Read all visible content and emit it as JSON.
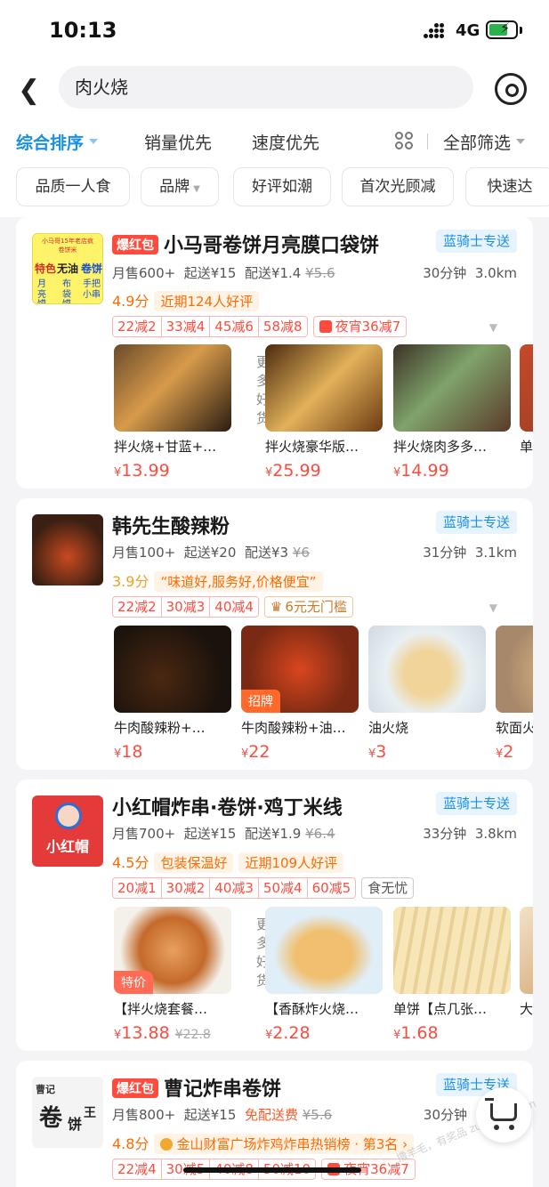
{
  "status": {
    "time": "10:13",
    "network": "4G"
  },
  "search": {
    "query": "肉火烧"
  },
  "sort": {
    "active": "综合排序",
    "sales": "销量优先",
    "speed": "速度优先",
    "filter": "全部筛选"
  },
  "chips": [
    "品质一人食",
    "品牌",
    "好评如潮",
    "首次光顾减",
    "快速达"
  ],
  "shops": [
    {
      "hot": "爆红包",
      "name": "小马哥卷饼月亮膜口袋饼",
      "delivery_tag": "蓝骑士专送",
      "monthly": "月售600+",
      "min": "起送¥15",
      "fee": "配送¥1.4",
      "fee_old": "¥5.6",
      "time": "30分钟",
      "dist": "3.0km",
      "score": "4.9分",
      "pills": [
        "近期124人好评"
      ],
      "coupons": [
        "22减2",
        "33减4",
        "45减6",
        "58减8"
      ],
      "extra": "夜宵36减7",
      "logo_text": [
        "小马哥15年老店疯",
        "卷饼米",
        "特色",
        "无油",
        "卷饼",
        "月",
        "布",
        "手把",
        "亮",
        "袋",
        "小串",
        "馍",
        "馍"
      ],
      "more": "更多好货",
      "dishes": [
        {
          "name": "拌火烧+甘蓝+…",
          "price": "13.99",
          "old": "",
          "badge": ""
        },
        {
          "name": "拌火烧豪华版…",
          "price": "25.99",
          "old": "",
          "badge": ""
        },
        {
          "name": "拌火烧肉多多…",
          "price": "14.99",
          "old": "",
          "badge": ""
        },
        {
          "name": "单",
          "price": "",
          "old": "",
          "badge": ""
        }
      ]
    },
    {
      "hot": "",
      "name": "韩先生酸辣粉",
      "delivery_tag": "蓝骑士专送",
      "monthly": "月售100+",
      "min": "起送¥20",
      "fee": "配送¥3",
      "fee_old": "¥6",
      "time": "31分钟",
      "dist": "3.1km",
      "score": "3.9分",
      "pills": [
        "“味道好,服务好,价格便宜”"
      ],
      "coupons": [
        "22减2",
        "30减3",
        "40减4"
      ],
      "extra": "6元无门槛",
      "dishes": [
        {
          "name": "牛肉酸辣粉+…",
          "price": "18",
          "old": "",
          "badge": ""
        },
        {
          "name": "牛肉酸辣粉+油…",
          "price": "22",
          "old": "",
          "badge": "招牌"
        },
        {
          "name": "油火烧",
          "price": "3",
          "old": "",
          "badge": ""
        },
        {
          "name": "软面火",
          "price": "2",
          "old": "",
          "badge": ""
        }
      ]
    },
    {
      "hot": "",
      "name": "小红帽炸串·卷饼·鸡丁米线",
      "delivery_tag": "蓝骑士专送",
      "monthly": "月售700+",
      "min": "起送¥15",
      "fee": "配送¥1.9",
      "fee_old": "¥6.4",
      "time": "33分钟",
      "dist": "3.8km",
      "score": "4.5分",
      "pills": [
        "包装保温好",
        "近期109人好评"
      ],
      "coupons": [
        "20减1",
        "30减2",
        "40减3",
        "50减4",
        "60减5"
      ],
      "extra": "食无忧",
      "logo_text": "小红帽",
      "more": "更多好货",
      "dishes": [
        {
          "name": "【拌火烧套餐…",
          "price": "13.88",
          "old": "22.8",
          "badge": "特价"
        },
        {
          "name": "【香酥炸火烧…",
          "price": "2.28",
          "old": "",
          "badge": ""
        },
        {
          "name": "单饼【点几张…",
          "price": "1.68",
          "old": "",
          "badge": ""
        },
        {
          "name": "大",
          "price": "",
          "old": "",
          "badge": ""
        }
      ]
    },
    {
      "hot": "爆红包",
      "name": "曹记炸串卷饼",
      "delivery_tag": "蓝骑士专送",
      "monthly": "月售800+",
      "min": "起送¥15",
      "fee": "免配送费",
      "fee_old": "¥5.6",
      "time": "30分钟",
      "dist": "",
      "score": "4.8分",
      "pills": [
        "金山财富广场炸鸡炸串热销榜 · 第3名"
      ],
      "coupons": [
        "22减4",
        "30减5",
        "40减8",
        "50减10"
      ],
      "extra": "夜宵36减7",
      "logo_text": [
        "曹记",
        "卷",
        "饼",
        "王"
      ]
    }
  ],
  "watermark": "撸羊毛，有奖品 zuanke8.com",
  "colors": {
    "accent_blue": "#1a8fea",
    "price_red": "#ff4b3e",
    "orange": "#ff6b00"
  }
}
